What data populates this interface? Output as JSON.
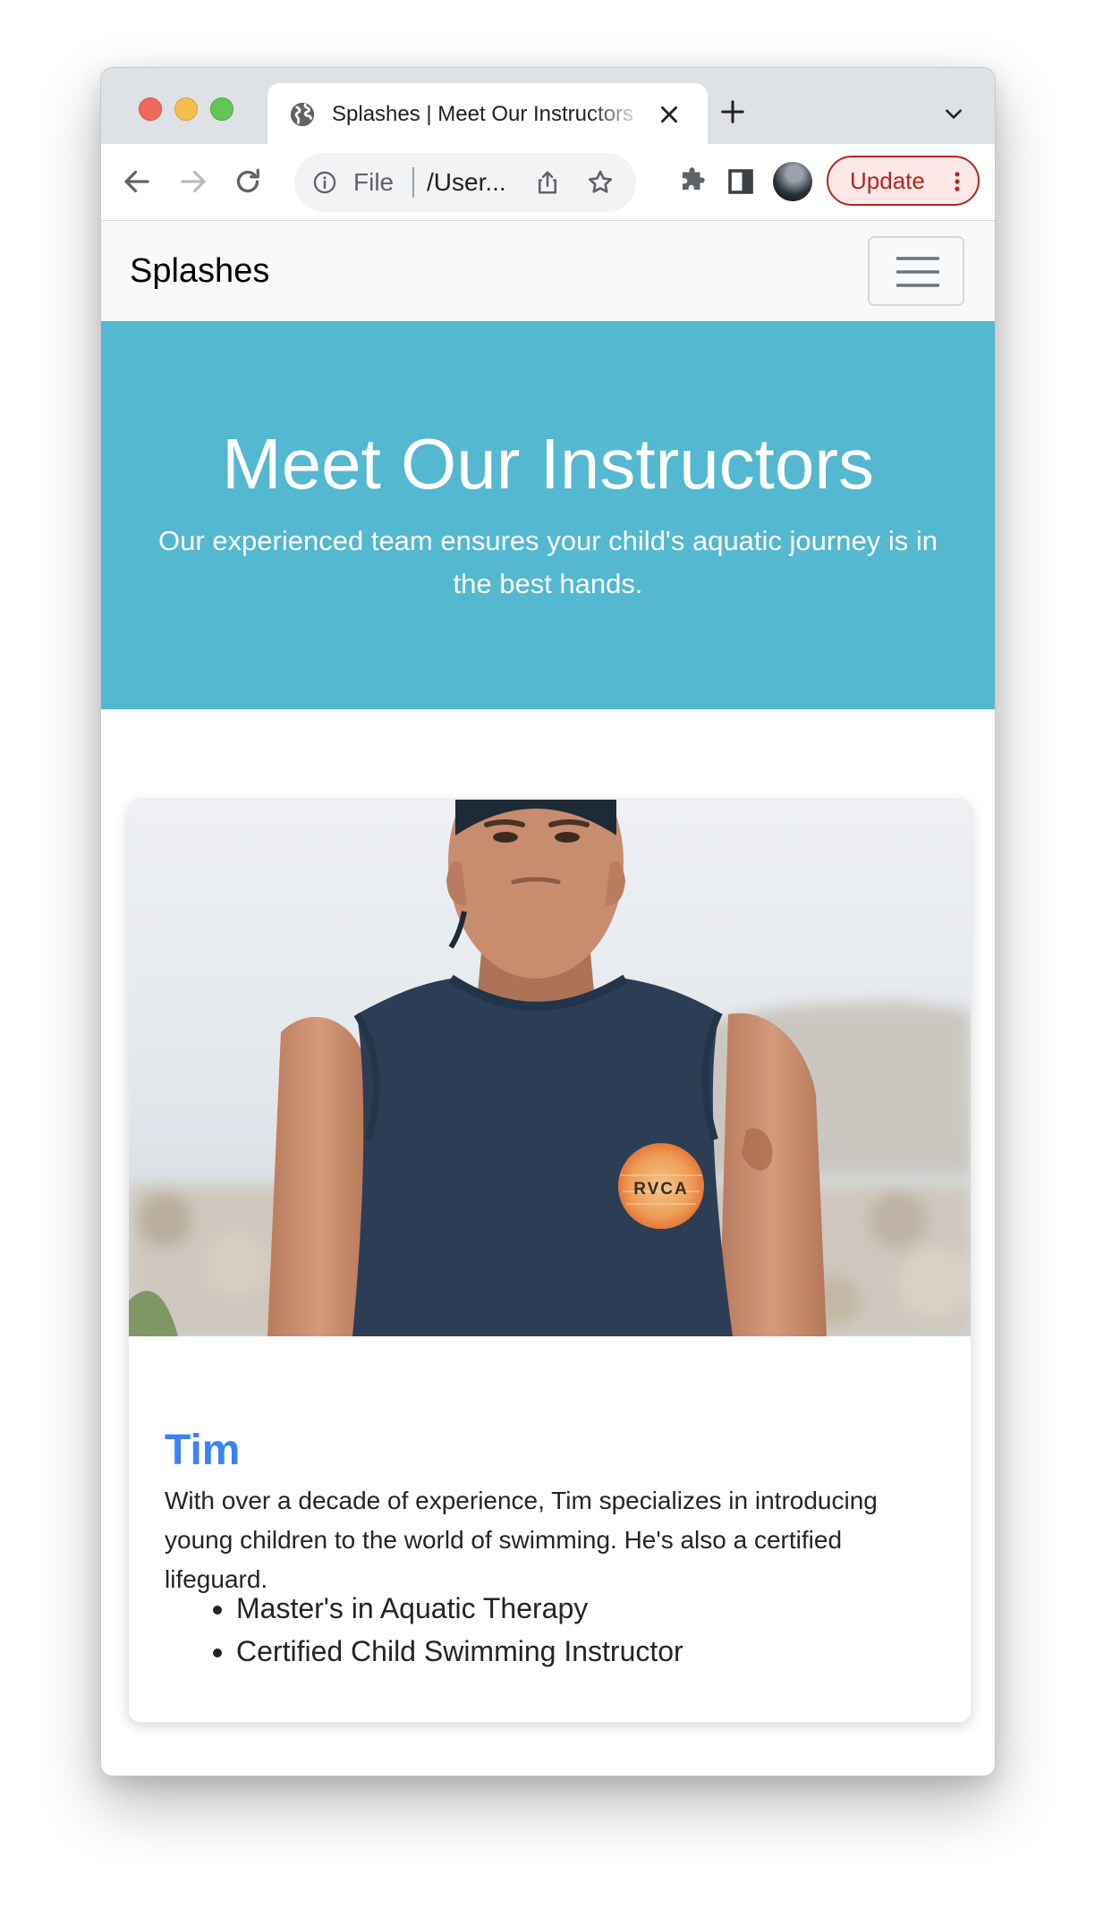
{
  "browser": {
    "tab_title": "Splashes | Meet Our Instructors",
    "omnibox": {
      "scheme_label": "File",
      "url": "/User..."
    },
    "update_label": "Update"
  },
  "navbar": {
    "brand": "Splashes"
  },
  "hero": {
    "title": "Meet Our Instructors",
    "subtitle": "Our experienced team ensures your child's aquatic journey is in the best hands."
  },
  "instructor": {
    "name": "Tim",
    "bio": "With over a decade of experience, Tim specializes in introducing young children to the world of swimming. He's also a certified lifeguard.",
    "qualifications": [
      "Master's in Aquatic Therapy",
      "Certified Child Swimming Instructor"
    ],
    "shirt_logo": "RVCA"
  },
  "colors": {
    "hero_bg": "#53b8d0",
    "instructor_name": "#3b82f6",
    "update_accent": "#b3261e"
  }
}
